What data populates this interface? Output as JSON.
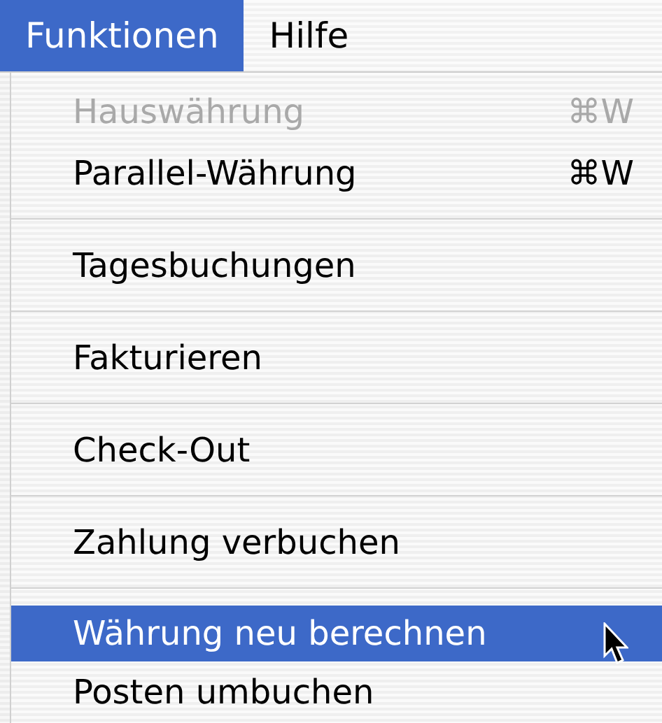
{
  "menu_bar": [
    {
      "label": "Funktionen",
      "selected": true
    },
    {
      "label": "Hilfe",
      "selected": false
    }
  ],
  "menu": {
    "items": [
      {
        "kind": "item",
        "label": "Hauswährung",
        "shortcut": "⌘W",
        "disabled": true,
        "selected": false
      },
      {
        "kind": "item",
        "label": "Parallel-Währung",
        "shortcut": "⌘W",
        "disabled": false,
        "selected": false
      },
      {
        "kind": "separator"
      },
      {
        "kind": "item",
        "label": "Tagesbuchungen",
        "disabled": false,
        "selected": false
      },
      {
        "kind": "separator"
      },
      {
        "kind": "item",
        "label": "Fakturieren",
        "disabled": false,
        "selected": false
      },
      {
        "kind": "separator"
      },
      {
        "kind": "item",
        "label": "Check-Out",
        "disabled": false,
        "selected": false
      },
      {
        "kind": "separator"
      },
      {
        "kind": "item",
        "label": "Zahlung verbuchen",
        "disabled": false,
        "selected": false
      },
      {
        "kind": "separator"
      },
      {
        "kind": "item",
        "label": "Währung neu berechnen",
        "disabled": false,
        "selected": true
      },
      {
        "kind": "item",
        "label": "Posten umbuchen",
        "disabled": false,
        "selected": false
      }
    ]
  }
}
